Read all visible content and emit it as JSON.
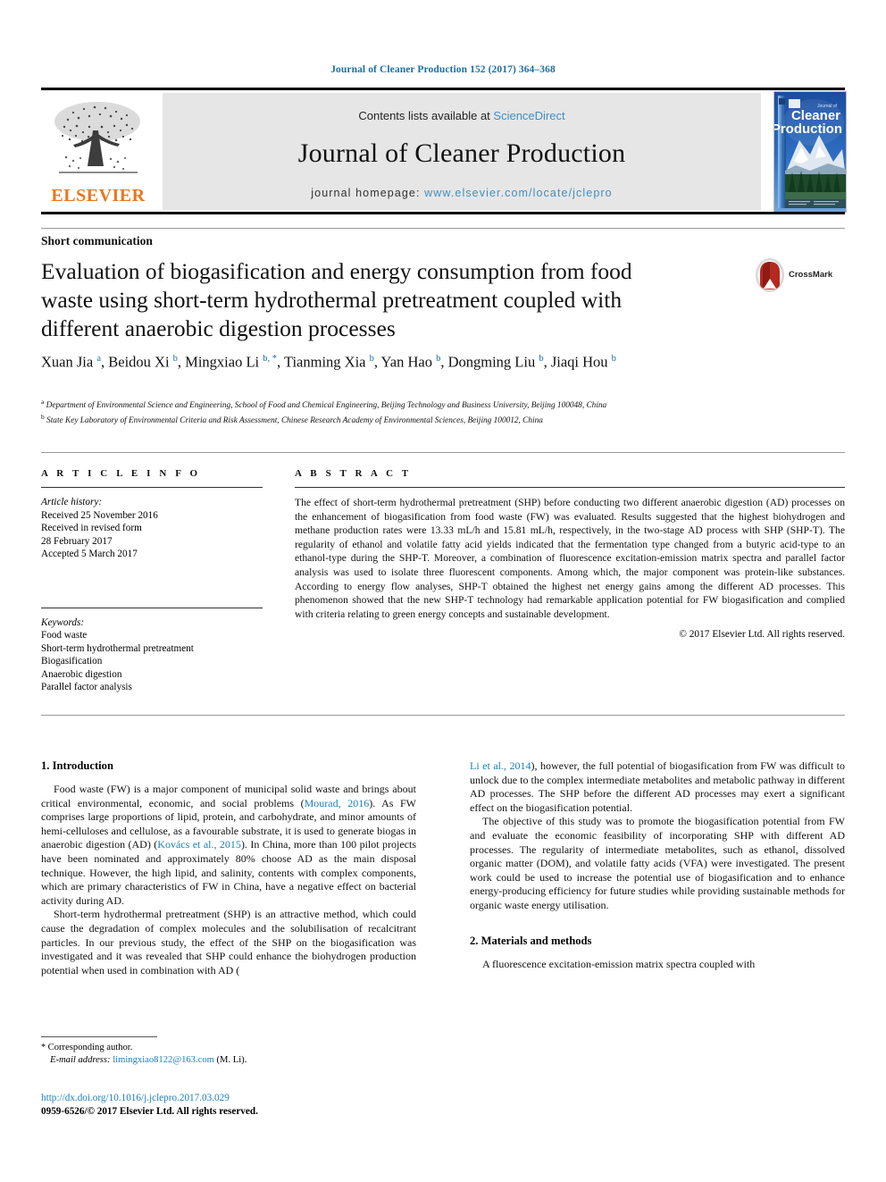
{
  "running_head": "Journal of Cleaner Production 152 (2017) 364–368",
  "masthead": {
    "contents_prefix": "Contents lists available at ",
    "sciencedirect": "ScienceDirect",
    "journal_name": "Journal of Cleaner Production",
    "homepage_prefix": "journal homepage: ",
    "homepage_url": "www.elsevier.com/locate/jclepro",
    "publisher": "ELSEVIER",
    "cover_title_small": "Journal of",
    "cover_title_line1": "Cleaner",
    "cover_title_line2": "Production"
  },
  "article": {
    "type": "Short communication",
    "title": "Evaluation of biogasification and energy consumption from food waste using short-term hydrothermal pretreatment coupled with different anaerobic digestion processes",
    "crossmark_label": "CrossMark",
    "authors": "Xuan Jia a, Beidou Xi b, Mingxiao Li b, *, Tianming Xia b, Yan Hao b, Dongming Liu b, Jiaqi Hou b",
    "affiliation_a": "Department of Environmental Science and Engineering, School of Food and Chemical Engineering, Beijing Technology and Business University, Beijing 100048, China",
    "affiliation_b": "State Key Laboratory of Environmental Criteria and Risk Assessment, Chinese Research Academy of Environmental Sciences, Beijing 100012, China"
  },
  "info": {
    "heading": "A R T I C L E  I N F O",
    "history_label": "Article history:",
    "history": [
      "Received 25 November 2016",
      "Received in revised form",
      "28 February 2017",
      "Accepted 5 March 2017"
    ],
    "keywords_label": "Keywords:",
    "keywords": [
      "Food waste",
      "Short-term hydrothermal pretreatment",
      "Biogasification",
      "Anaerobic digestion",
      "Parallel factor analysis"
    ]
  },
  "abstract": {
    "heading": "A B S T R A C T",
    "text": "The effect of short-term hydrothermal pretreatment (SHP) before conducting two different anaerobic digestion (AD) processes on the enhancement of biogasification from food waste (FW) was evaluated. Results suggested that the highest biohydrogen and methane production rates were 13.33 mL/h and 15.81 mL/h, respectively, in the two-stage AD process with SHP (SHP-T). The regularity of ethanol and volatile fatty acid yields indicated that the fermentation type changed from a butyric acid-type to an ethanol-type during the SHP-T. Moreover, a combination of fluorescence excitation-emission matrix spectra and parallel factor analysis was used to isolate three fluorescent components. Among which, the major component was protein-like substances. According to energy flow analyses, SHP-T obtained the highest net energy gains among the different AD processes. This phenomenon showed that the new SHP-T technology had remarkable application potential for FW biogasification and complied with criteria relating to green energy concepts and sustainable development.",
    "copyright": "© 2017 Elsevier Ltd. All rights reserved."
  },
  "sections": {
    "intro_heading": "1. Introduction",
    "intro_p1_a": "Food waste (FW) is a major component of municipal solid waste and brings about critical environmental, economic, and social problems (",
    "intro_p1_cite1": "Mourad, 2016",
    "intro_p1_b": "). As FW comprises large proportions of lipid, protein, and carbohydrate, and minor amounts of hemi-celluloses and cellulose, as a favourable substrate, it is used to generate biogas in anaerobic digestion (AD) (",
    "intro_p1_cite2": "Kovács et al., 2015",
    "intro_p1_c": "). In China, more than 100 pilot projects have been nominated and approximately 80% choose AD as the main disposal technique. However, the high lipid, and salinity, contents with complex components, which are primary characteristics of FW in China, have a negative effect on bacterial activity during AD.",
    "intro_p2_a": "Short-term hydrothermal pretreatment (SHP) is an attractive method, which could cause the degradation of complex molecules and the solubilisation of recalcitrant particles. In our previous study, the effect of the SHP on the biogasification was investigated and it was revealed that SHP could enhance the biohydrogen production potential when used in combination with AD (",
    "intro_p2_cite1": "Li et al., 2014",
    "intro_p2_b": "), however, the full potential of biogasification from FW was difficult to unlock due to the complex intermediate metabolites and metabolic pathway in different AD processes. The SHP before the different AD processes may exert a significant effect on the biogasification potential.",
    "intro_p3": "The objective of this study was to promote the biogasification potential from FW and evaluate the economic feasibility of incorporating SHP with different AD processes. The regularity of intermediate metabolites, such as ethanol, dissolved organic matter (DOM), and volatile fatty acids (VFA) were investigated. The present work could be used to increase the potential use of biogasification and to enhance energy-producing efficiency for future studies while providing sustainable methods for organic waste energy utilisation.",
    "methods_heading": "2. Materials and methods",
    "methods_p1": "A fluorescence excitation-emission matrix spectra coupled with"
  },
  "footer": {
    "corresponding_star": "*",
    "corresponding_label": "Corresponding author.",
    "email_label": "E-mail address:",
    "email": "limingxiao8122@163.com",
    "email_suffix": "(M. Li).",
    "doi": "http://dx.doi.org/10.1016/j.jclepro.2017.03.029",
    "issn": "0959-6526/© 2017 Elsevier Ltd. All rights reserved."
  },
  "colors": {
    "link": "#1a7fb8",
    "header_blue": "#1a6fa8",
    "elsevier_orange": "#e87722",
    "masthead_gray": "#e6e6e6"
  }
}
